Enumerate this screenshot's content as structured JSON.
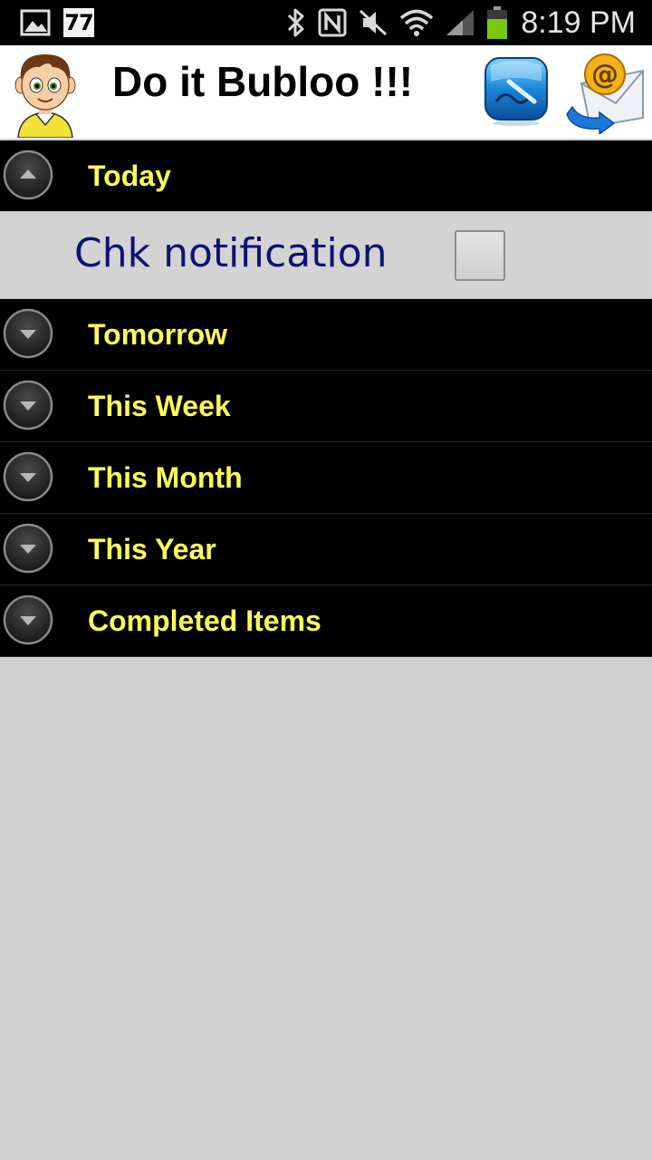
{
  "status_bar": {
    "time": "8:19 PM",
    "notification_count": "77",
    "icons": [
      "gallery-icon",
      "calendar-77-icon",
      "bluetooth-icon",
      "nfc-icon",
      "mute-icon",
      "wifi-icon",
      "signal-icon",
      "battery-icon"
    ],
    "battery_color": "#7ac70c"
  },
  "header": {
    "title": "Do it Bubloo !!!",
    "icons": [
      "boy-avatar-icon",
      "sign-pen-icon",
      "email-icon"
    ]
  },
  "sections": [
    {
      "label": "Today",
      "expanded": true,
      "icon": "chevron-up-icon"
    },
    {
      "label": "Tomorrow",
      "expanded": false,
      "icon": "chevron-down-icon"
    },
    {
      "label": "This Week",
      "expanded": false,
      "icon": "chevron-down-icon"
    },
    {
      "label": "This Month",
      "expanded": false,
      "icon": "chevron-down-icon"
    },
    {
      "label": "This Year",
      "expanded": false,
      "icon": "chevron-down-icon"
    },
    {
      "label": "Completed Items",
      "expanded": false,
      "icon": "chevron-down-icon"
    }
  ],
  "today_items": [
    {
      "label": "Chk notification",
      "checked": false
    }
  ],
  "colors": {
    "section_text": "#ffff55",
    "item_text": "#0d1470",
    "background": "#d0d0d0"
  }
}
